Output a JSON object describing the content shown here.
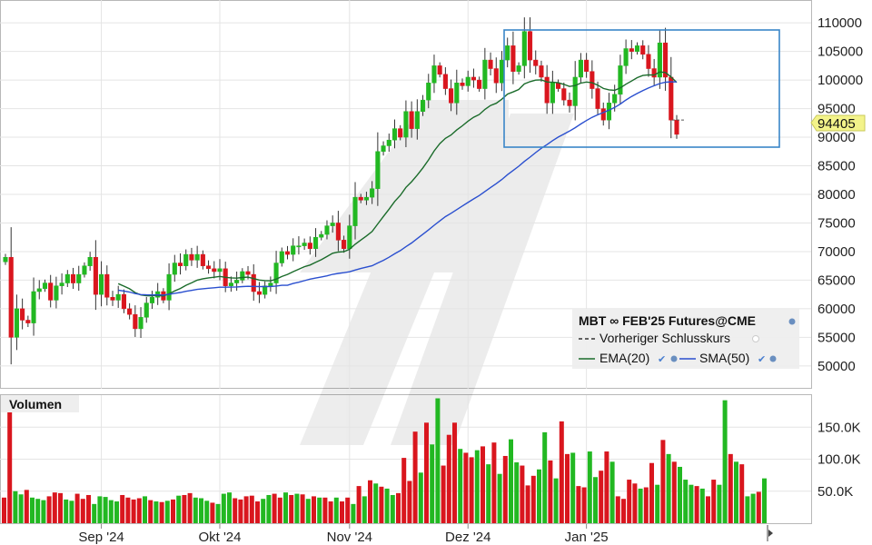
{
  "chart_data": [
    {
      "type": "candlestick",
      "title": "MBT ∞ FEB'25 Futures@CME",
      "ylim": [
        46000,
        114000
      ],
      "y_ticks": [
        50000,
        55000,
        60000,
        65000,
        70000,
        75000,
        80000,
        85000,
        90000,
        95000,
        100000,
        105000,
        110000
      ],
      "y_tick_labels": [
        "50000",
        "55000",
        "60000",
        "65000",
        "70000",
        "75000",
        "80000",
        "85000",
        "90000",
        "95000",
        "100000",
        "105000",
        "110000"
      ],
      "x_labels": [
        {
          "label": "Sep '24",
          "index": 17
        },
        {
          "label": "Okt '24",
          "index": 38
        },
        {
          "label": "Nov '24",
          "index": 61
        },
        {
          "label": "Dez '24",
          "index": 82
        },
        {
          "label": "Jan '25",
          "index": 103
        }
      ],
      "last_price": "94405",
      "legend": {
        "title": "MBT ∞ FEB'25 Futures@CME",
        "items": [
          {
            "label": "Vorheriger Schlusskurs",
            "style": "dashed",
            "color": "#333333"
          },
          {
            "label": "EMA(20)",
            "style": "solid",
            "color": "#1a6b2a"
          },
          {
            "label": "SMA(50)",
            "style": "solid",
            "color": "#2a4fcf"
          }
        ]
      },
      "colors": {
        "up": "#22b822",
        "down": "#d9161e",
        "ema": "#1a6b2a",
        "sma": "#2a4fcf",
        "box": "#3a86c8"
      },
      "closes": [
        69000,
        55000,
        60000,
        58000,
        57500,
        63000,
        63500,
        64500,
        61500,
        64000,
        64500,
        66000,
        64500,
        66000,
        67500,
        69000,
        62500,
        66000,
        62000,
        61500,
        62500,
        60000,
        59000,
        56500,
        58500,
        61000,
        62000,
        63000,
        61500,
        66000,
        68000,
        67500,
        69500,
        68500,
        69500,
        67500,
        67000,
        66500,
        67000,
        64000,
        64500,
        65000,
        66500,
        66000,
        63000,
        62500,
        64000,
        64500,
        68000,
        70000,
        69500,
        71000,
        71000,
        71500,
        70500,
        72500,
        73000,
        74500,
        75000,
        72000,
        70500,
        74500,
        79500,
        79000,
        79500,
        81000,
        87500,
        88500,
        89500,
        91500,
        90000,
        94500,
        91500,
        94500,
        96500,
        99500,
        102500,
        101000,
        98500,
        96000,
        99500,
        99000,
        100500,
        100000,
        98500,
        103500,
        102000,
        99500,
        103500,
        106000,
        101500,
        102500,
        108500,
        103500,
        102500,
        100500,
        96000,
        99500,
        98500,
        96500,
        95500,
        100500,
        103500,
        101500,
        98500,
        95000,
        93000,
        96000,
        97500,
        102500,
        105500,
        105000,
        106000,
        104500,
        102000,
        100500,
        106500,
        100500,
        93000,
        90500
      ],
      "volume": {
        "title": "Volumen",
        "ylim": [
          0,
          200000
        ],
        "ticks": [
          50000,
          100000,
          150000
        ],
        "tick_labels": [
          "50.0K",
          "100.0K",
          "150.0K"
        ],
        "values": [
          40000,
          180000,
          50000,
          45000,
          52000,
          40000,
          38000,
          36000,
          42000,
          48000,
          47000,
          37000,
          35000,
          46000,
          38000,
          44000,
          30000,
          42000,
          41000,
          36000,
          34000,
          44000,
          40000,
          37000,
          39000,
          42000,
          36000,
          34000,
          33000,
          35000,
          37000,
          43000,
          44000,
          47000,
          40000,
          39000,
          35000,
          32000,
          30000,
          46000,
          48000,
          39000,
          37000,
          42000,
          43000,
          34000,
          38000,
          44000,
          46000,
          40000,
          48000,
          44000,
          46000,
          45000,
          38000,
          42000,
          40000,
          40000,
          34000,
          40000,
          34000,
          40000,
          30000,
          58000,
          42000,
          67000,
          62000,
          57000,
          54000,
          44000,
          47000,
          102000,
          66000,
          143000,
          79000,
          157000,
          123000,
          195000,
          90000,
          138000,
          157000,
          116000,
          110000,
          103000,
          114000,
          120000,
          92000,
          126000,
          77000,
          105000,
          131000,
          95000,
          90000,
          59000,
          74000,
          84000,
          142000,
          98000,
          70000,
          159000,
          108000,
          110000,
          58000,
          56000,
          112000,
          72000,
          82000,
          112000,
          96000,
          42000,
          38000,
          68000,
          62000,
          54000,
          56000,
          94000,
          60000,
          130000,
          108000,
          96000,
          88000,
          68000,
          60000,
          58000,
          54000,
          42000,
          68000,
          60000,
          192000,
          108000,
          96000,
          92000,
          42000,
          46000,
          49000,
          70000
        ]
      }
    }
  ]
}
